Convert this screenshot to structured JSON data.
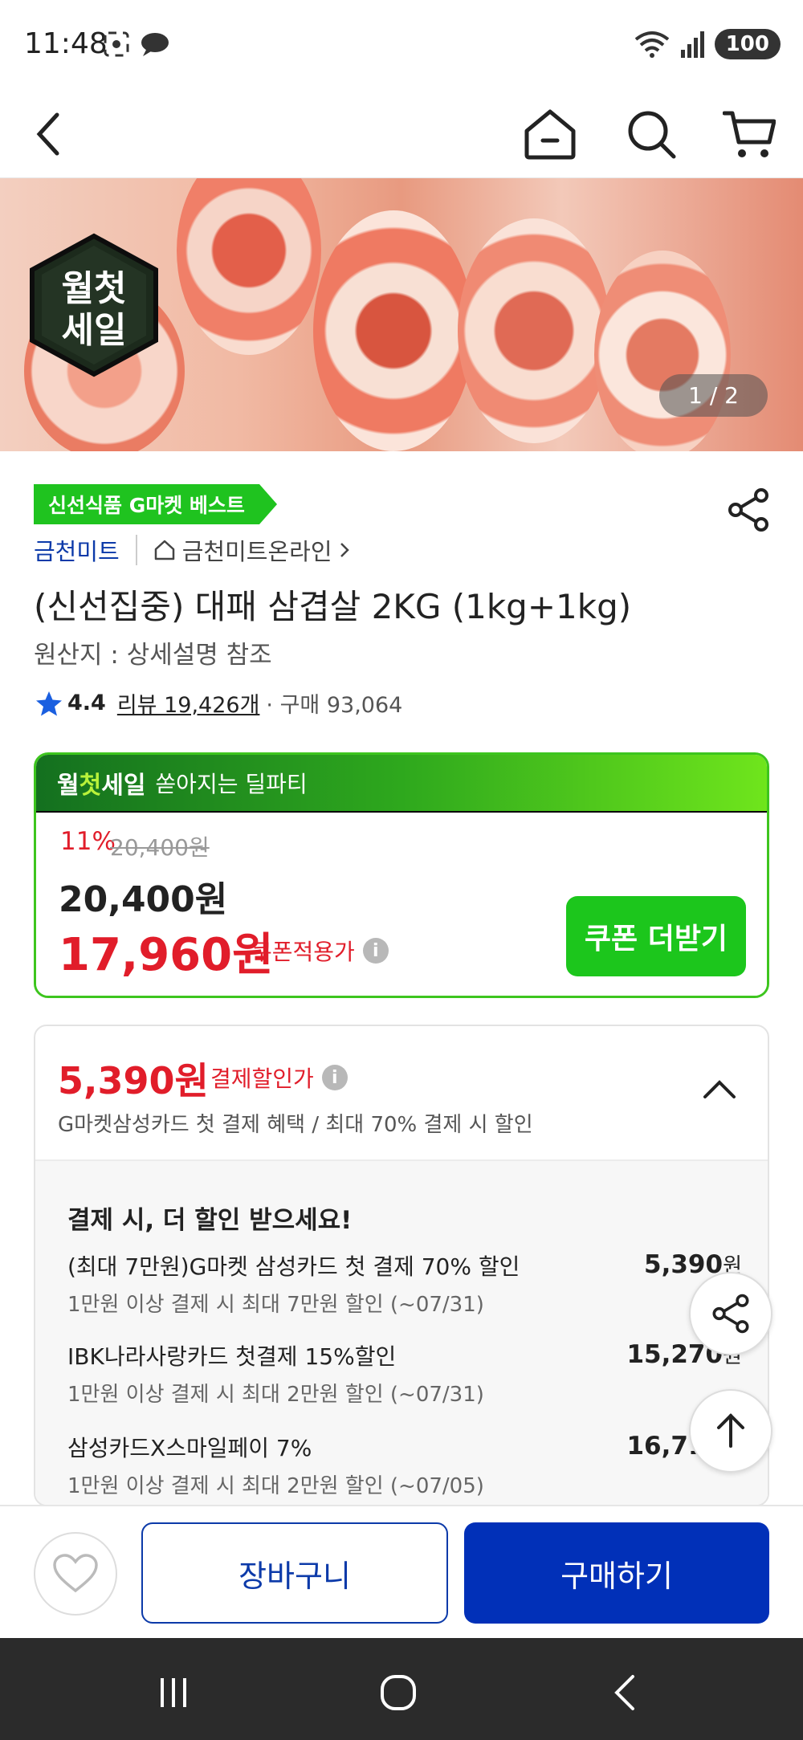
{
  "status_bar": {
    "time": "11:48",
    "battery": "100"
  },
  "hero": {
    "page_indicator": "1 / 2",
    "badge_lines": [
      "월첫",
      "세일"
    ]
  },
  "product": {
    "best_tag": "신선식품 G마켓 베스트",
    "seller": "금천미트",
    "store": "금천미트온라인",
    "title": "(신선집중) 대패 삼겹살 2KG (1kg+1kg)",
    "origin": "원산지 : 상세설명 참조",
    "rating": "4.4",
    "reviews": "리뷰 19,426개",
    "purchases": "구매 93,064"
  },
  "deal": {
    "brand_pre": "월",
    "brand_highlight": "첫",
    "brand_post": "세일",
    "subtitle": "쏟아지는 딜파티",
    "discount_pct": "11%",
    "original_price": "20,400원",
    "price": "20,400원",
    "coupon_price": "17,960원",
    "coupon_label": "쿠폰적용가",
    "coupon_button": "쿠폰 더받기"
  },
  "payment": {
    "price": "5,390원",
    "label": "결제할인가",
    "desc": "G마켓삼성카드 첫 결제 혜택 / 최대 70% 결제 시 할인",
    "list_title": "결제 시, 더 할인 받으세요!",
    "items": [
      {
        "name": "(최대 7만원)G마켓 삼성카드 첫 결제 70% 할인",
        "sub": "1만원 이상 결제 시 최대 7만원 할인 (~07/31)",
        "price": "5,390",
        "unit": "원"
      },
      {
        "name": "IBK나라사랑카드 첫결제 15%할인",
        "sub": "1만원 이상 결제 시 최대 2만원 할인 (~07/31)",
        "price": "15,270",
        "unit": "원"
      },
      {
        "name": "삼성카드X스마일페이 7%",
        "sub": "1만원 이상 결제 시 최대 2만원 할인 (~07/05)",
        "price": "16,710",
        "unit": "원"
      }
    ]
  },
  "bottom_bar": {
    "cart": "장바구니",
    "buy": "구매하기"
  },
  "colors": {
    "brand_blue": "#0130b8",
    "deal_green": "#1cc61c",
    "price_red": "#e11d2a"
  }
}
